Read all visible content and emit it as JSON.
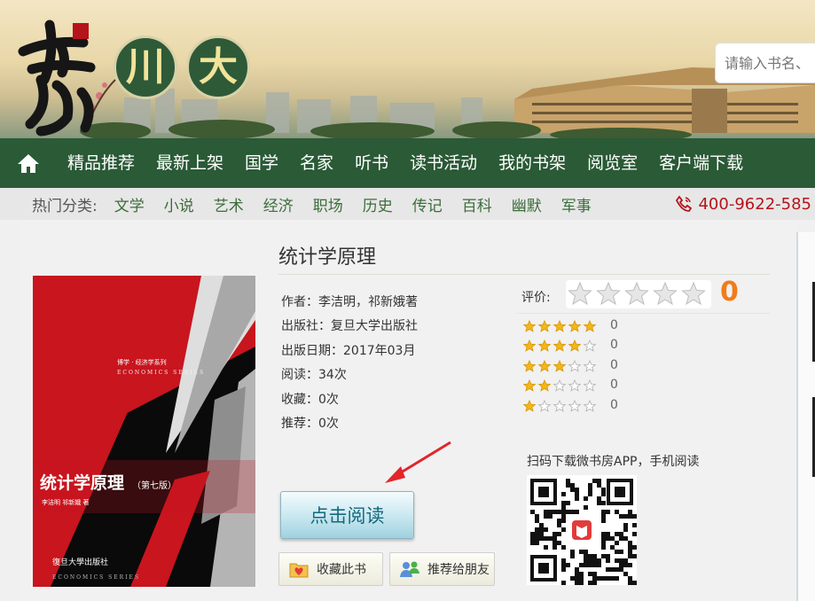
{
  "header": {
    "logo_text": "书香",
    "circle1": "川",
    "circle2": "大",
    "search_placeholder": "请输入书名、"
  },
  "nav": {
    "items": [
      "精品推荐",
      "最新上架",
      "国学",
      "名家",
      "听书",
      "读书活动",
      "我的书架",
      "阅览室",
      "客户端下载"
    ]
  },
  "categories": {
    "label": "热门分类:",
    "items": [
      "文学",
      "小说",
      "艺术",
      "经济",
      "职场",
      "历史",
      "传记",
      "百科",
      "幽默",
      "军事"
    ],
    "phone": "400-9622-585"
  },
  "book": {
    "title": "统计学原理",
    "author": "作者：李洁明，祁新娥著",
    "publisher": "出版社：复旦大学出版社",
    "date": "出版日期：2017年03月",
    "reads": "阅读：34次",
    "favorites": "收藏：0次",
    "recommends": "推荐：0次",
    "cover": {
      "series_cn": "博学 · 经济学系列",
      "series_en": "ECONOMICS SERIES",
      "title": "统计学原理",
      "edition": "（第七版）",
      "authors": "李洁明   祁新娥   著",
      "press": "復旦大學出版社",
      "footer_en": "ECONOMICS SERIES"
    }
  },
  "rating": {
    "label": "评价:",
    "score": "0",
    "distribution": [
      {
        "stars": 5,
        "count": "0"
      },
      {
        "stars": 4,
        "count": "0"
      },
      {
        "stars": 3,
        "count": "0"
      },
      {
        "stars": 2,
        "count": "0"
      },
      {
        "stars": 1,
        "count": "0"
      }
    ]
  },
  "actions": {
    "read": "点击阅读",
    "favorite": "收藏此书",
    "recommend": "推荐给朋友"
  },
  "qr": {
    "caption": "扫码下载微书房APP，手机阅读"
  },
  "colors": {
    "nav_green": "#2a5a36",
    "category_green": "#3c6d3a",
    "phone_red": "#b5141b",
    "score_orange": "#f27b19",
    "cover_red": "#c8151e"
  }
}
